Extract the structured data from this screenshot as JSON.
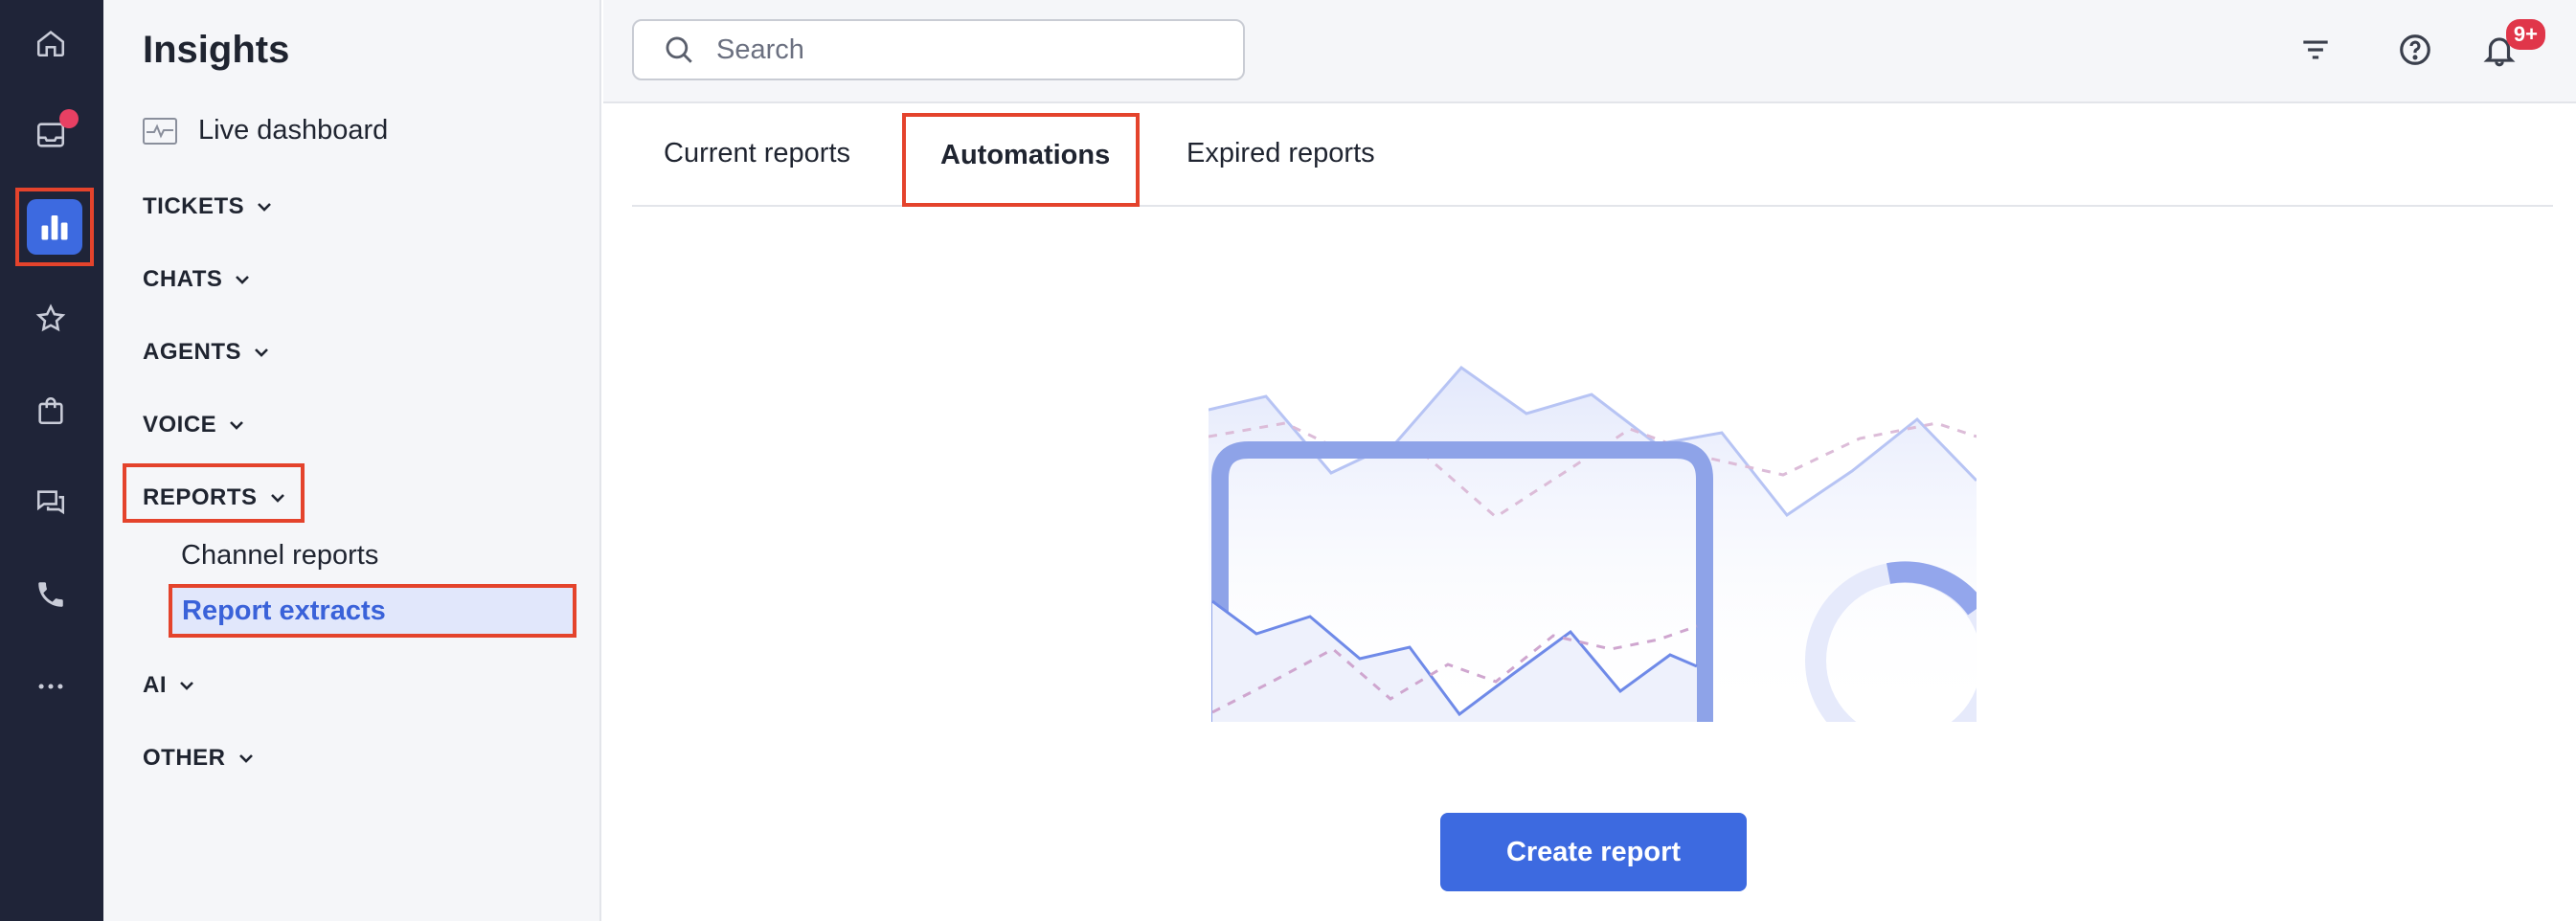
{
  "rail": {
    "items": [
      "home-icon",
      "inbox-icon",
      "insights-icon",
      "star-icon",
      "shopping-bag-icon",
      "chat-icon",
      "phone-icon",
      "more-icon"
    ],
    "accent": "#3d6ae0"
  },
  "nav": {
    "title": "Insights",
    "live_dashboard": "Live dashboard",
    "sections": {
      "tickets": "TICKETS",
      "chats": "CHATS",
      "agents": "AGENTS",
      "voice": "VOICE",
      "reports": "REPORTS",
      "ai": "AI",
      "other": "OTHER"
    },
    "reports_items": {
      "channel": "Channel reports",
      "extracts": "Report extracts"
    }
  },
  "topbar": {
    "search_placeholder": "Search",
    "notifications_badge": "9+"
  },
  "tabs": {
    "current": "Current reports",
    "automations": "Automations",
    "expired": "Expired reports"
  },
  "main": {
    "create_button": "Create report"
  },
  "colors": {
    "highlight": "#e4432c",
    "primary": "#3d6ae0",
    "badge": "#e0364a"
  }
}
